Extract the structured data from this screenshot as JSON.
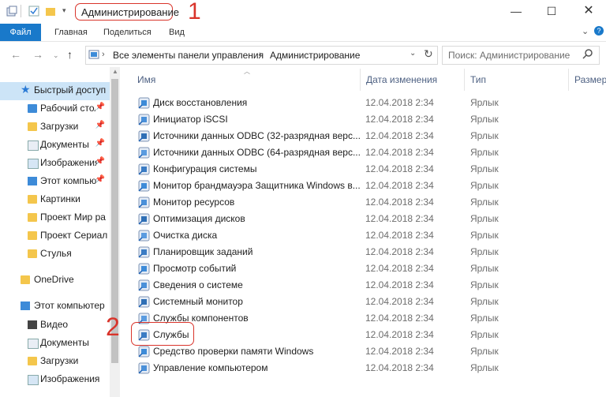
{
  "window": {
    "title": "Администрирование",
    "annotation_1": "1",
    "annotation_2": "2"
  },
  "ribbon": {
    "tabs": [
      "Файл",
      "Главная",
      "Поделиться",
      "Вид"
    ]
  },
  "address": {
    "segments": [
      "Все элементы панели управления",
      "Администрирование"
    ],
    "separator": "›"
  },
  "search": {
    "placeholder": "Поиск: Администрирование"
  },
  "sidebar": {
    "items": [
      {
        "label": "Быстрый доступ",
        "icon": "star-icon",
        "pinned": false
      },
      {
        "label": "Рабочий стол",
        "icon": "desktop-folder-icon",
        "pinned": true
      },
      {
        "label": "Загрузки",
        "icon": "downloads-folder-icon",
        "pinned": true
      },
      {
        "label": "Документы",
        "icon": "documents-folder-icon",
        "pinned": true
      },
      {
        "label": "Изображения",
        "icon": "pictures-folder-icon",
        "pinned": true
      },
      {
        "label": "Этот компьютер",
        "icon": "computer-icon",
        "pinned": true
      },
      {
        "label": "Картинки",
        "icon": "folder-icon",
        "pinned": false
      },
      {
        "label": "Проект Мир ра",
        "icon": "folder-icon",
        "pinned": false
      },
      {
        "label": "Проект Сериал",
        "icon": "folder-icon",
        "pinned": false
      },
      {
        "label": "Стулья",
        "icon": "folder-icon",
        "pinned": false
      },
      {
        "label": "OneDrive",
        "icon": "onedrive-folder-icon",
        "pinned": false
      },
      {
        "label": "Этот компьютер",
        "icon": "computer-icon",
        "pinned": false
      },
      {
        "label": "Видео",
        "icon": "video-folder-icon",
        "pinned": false
      },
      {
        "label": "Документы",
        "icon": "documents-folder-icon",
        "pinned": false
      },
      {
        "label": "Загрузки",
        "icon": "downloads-folder-icon",
        "pinned": false
      },
      {
        "label": "Изображения",
        "icon": "pictures-folder-icon",
        "pinned": false
      }
    ],
    "pin_glyph": "📌"
  },
  "columns": {
    "name": "Имя",
    "date": "Дата изменения",
    "type": "Тип",
    "size": "Размер"
  },
  "files": [
    {
      "name": "Диск восстановления",
      "date": "12.04.2018 2:34",
      "type": "Ярлык"
    },
    {
      "name": "Инициатор iSCSI",
      "date": "12.04.2018 2:34",
      "type": "Ярлык"
    },
    {
      "name": "Источники данных ODBC (32-разрядная верс...",
      "date": "12.04.2018 2:34",
      "type": "Ярлык"
    },
    {
      "name": "Источники данных ODBC (64-разрядная верс...",
      "date": "12.04.2018 2:34",
      "type": "Ярлык"
    },
    {
      "name": "Конфигурация системы",
      "date": "12.04.2018 2:34",
      "type": "Ярлык"
    },
    {
      "name": "Монитор брандмауэра Защитника Windows в...",
      "date": "12.04.2018 2:34",
      "type": "Ярлык"
    },
    {
      "name": "Монитор ресурсов",
      "date": "12.04.2018 2:34",
      "type": "Ярлык"
    },
    {
      "name": "Оптимизация дисков",
      "date": "12.04.2018 2:34",
      "type": "Ярлык"
    },
    {
      "name": "Очистка диска",
      "date": "12.04.2018 2:34",
      "type": "Ярлык"
    },
    {
      "name": "Планировщик заданий",
      "date": "12.04.2018 2:34",
      "type": "Ярлык"
    },
    {
      "name": "Просмотр событий",
      "date": "12.04.2018 2:34",
      "type": "Ярлык"
    },
    {
      "name": "Сведения о системе",
      "date": "12.04.2018 2:34",
      "type": "Ярлык"
    },
    {
      "name": "Системный монитор",
      "date": "12.04.2018 2:34",
      "type": "Ярлык"
    },
    {
      "name": "Службы компонентов",
      "date": "12.04.2018 2:34",
      "type": "Ярлык"
    },
    {
      "name": "Службы",
      "date": "12.04.2018 2:34",
      "type": "Ярлык"
    },
    {
      "name": "Средство проверки памяти Windows",
      "date": "12.04.2018 2:34",
      "type": "Ярлык"
    },
    {
      "name": "Управление компьютером",
      "date": "12.04.2018 2:34",
      "type": "Ярлык"
    }
  ],
  "colors": {
    "accent": "#1979ca",
    "annotation": "#d9342b",
    "header_text": "#4d6082"
  }
}
